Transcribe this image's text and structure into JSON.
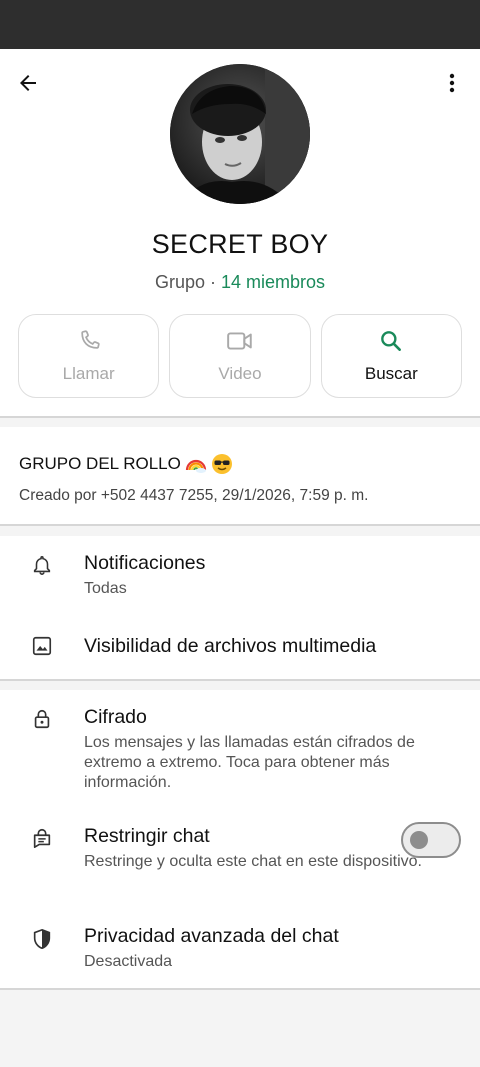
{
  "header": {
    "title": "SECRET BOY",
    "subtitle_prefix": "Grupo · ",
    "members": "14 miembros"
  },
  "actions": [
    {
      "label": "Llamar",
      "icon": "phone-icon",
      "enabled": false
    },
    {
      "label": "Video",
      "icon": "video-icon",
      "enabled": false
    },
    {
      "label": "Buscar",
      "icon": "search-icon",
      "enabled": true
    }
  ],
  "description": {
    "title": "GRUPO DEL ROLLO",
    "emojis": [
      "rainbow-emoji",
      "sunglasses-emoji"
    ],
    "created": "Creado por +502 4437 7255, 29/1/2026, 7:59 p. m."
  },
  "settings": {
    "notifications": {
      "title": "Notificaciones",
      "value": "Todas",
      "icon": "bell-icon"
    },
    "media_visibility": {
      "title": "Visibilidad de archivos multimedia",
      "icon": "image-icon"
    }
  },
  "privacy": {
    "encryption": {
      "title": "Cifrado",
      "desc": "Los mensajes y las llamadas están cifrados de extremo a extremo. Toca para obtener más información.",
      "icon": "lock-icon"
    },
    "restrict": {
      "title": "Restringir chat",
      "desc": "Restringe y oculta este chat en este dispositivo.",
      "icon": "locked-chat-icon",
      "enabled": false
    },
    "advanced": {
      "title": "Privacidad avanzada del chat",
      "value": "Desactivada",
      "icon": "shield-icon"
    }
  },
  "colors": {
    "accent": "#1a8a5a",
    "statusbar": "#2e2e2e",
    "background": "#f4f4f4"
  }
}
